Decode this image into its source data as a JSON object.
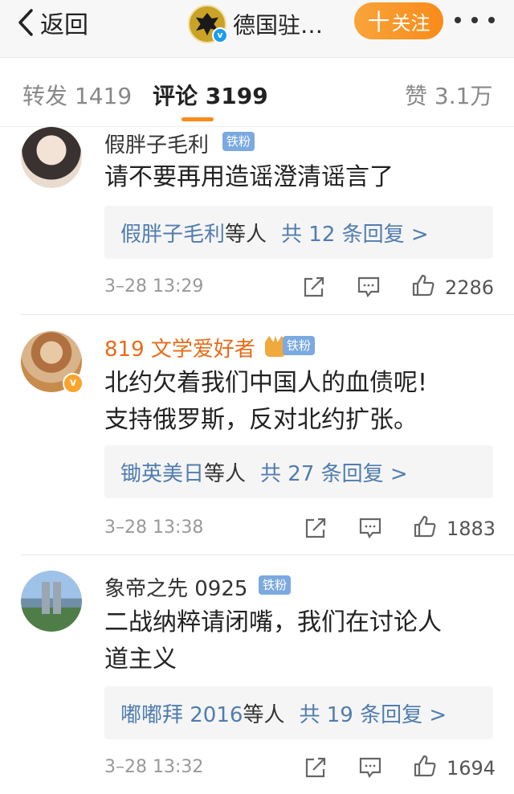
{
  "nav": {
    "back_label": "返回",
    "account_name": "德国驻…",
    "follow_label": "关注",
    "follow_plus": "十"
  },
  "tabs": {
    "repost": "转发 1419",
    "comments": "评论 3199",
    "likes": "赞 3.1万"
  },
  "comments": [
    {
      "username": "假胖子毛利",
      "badge": "铁粉",
      "text": "请不要再用造谣澄清谣言了",
      "reply_user": "假胖子毛利",
      "reply_etc": "等人",
      "reply_count": "共 12 条回复 >",
      "time": "3–28 13:29",
      "likes": "2286"
    },
    {
      "username": "819 文学爱好者",
      "badge": "铁粉",
      "text_line1": "北约欠着我们中国人的血债呢!",
      "text_line2": "支持俄罗斯，反对北约扩张。",
      "reply_user": "锄英美日",
      "reply_etc": "等人",
      "reply_count": "共 27 条回复 >",
      "time": "3–28 13:38",
      "likes": "1883"
    },
    {
      "username": "象帝之先 0925",
      "badge": "铁粉",
      "text_line1": "二战纳粹请闭嘴，我们在讨论人",
      "text_line2": "道主义",
      "reply_user": "嘟嘟拜 2016",
      "reply_etc": "等人",
      "reply_count": "共 19 条回复 >",
      "time": "3–28 13:32",
      "likes": "1694"
    }
  ],
  "colors": {
    "accent_orange": "#f98b1a",
    "link_blue": "#507daf",
    "fan_badge": "#7ba9e0"
  }
}
